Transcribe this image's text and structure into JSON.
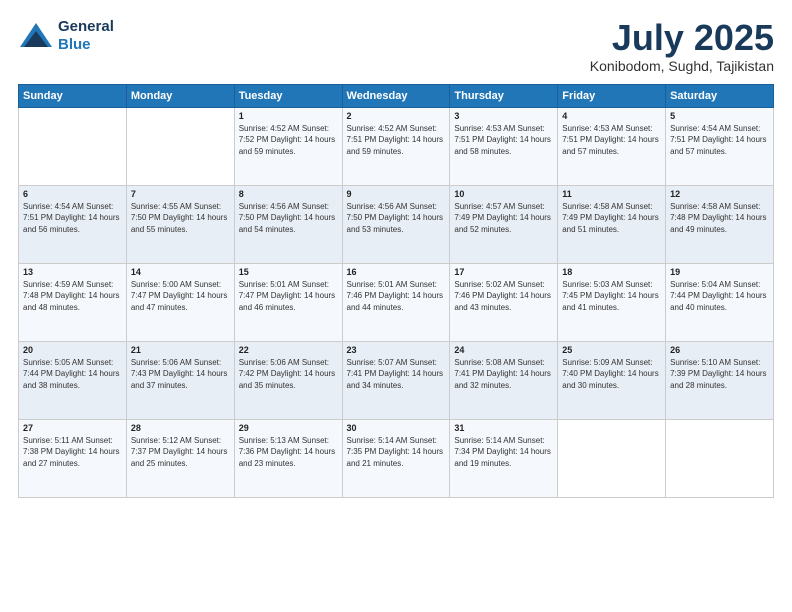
{
  "logo": {
    "line1": "General",
    "line2": "Blue"
  },
  "header": {
    "month": "July 2025",
    "location": "Konibodom, Sughd, Tajikistan"
  },
  "weekdays": [
    "Sunday",
    "Monday",
    "Tuesday",
    "Wednesday",
    "Thursday",
    "Friday",
    "Saturday"
  ],
  "weeks": [
    [
      {
        "num": "",
        "info": ""
      },
      {
        "num": "",
        "info": ""
      },
      {
        "num": "1",
        "info": "Sunrise: 4:52 AM\nSunset: 7:52 PM\nDaylight: 14 hours and 59 minutes."
      },
      {
        "num": "2",
        "info": "Sunrise: 4:52 AM\nSunset: 7:51 PM\nDaylight: 14 hours and 59 minutes."
      },
      {
        "num": "3",
        "info": "Sunrise: 4:53 AM\nSunset: 7:51 PM\nDaylight: 14 hours and 58 minutes."
      },
      {
        "num": "4",
        "info": "Sunrise: 4:53 AM\nSunset: 7:51 PM\nDaylight: 14 hours and 57 minutes."
      },
      {
        "num": "5",
        "info": "Sunrise: 4:54 AM\nSunset: 7:51 PM\nDaylight: 14 hours and 57 minutes."
      }
    ],
    [
      {
        "num": "6",
        "info": "Sunrise: 4:54 AM\nSunset: 7:51 PM\nDaylight: 14 hours and 56 minutes."
      },
      {
        "num": "7",
        "info": "Sunrise: 4:55 AM\nSunset: 7:50 PM\nDaylight: 14 hours and 55 minutes."
      },
      {
        "num": "8",
        "info": "Sunrise: 4:56 AM\nSunset: 7:50 PM\nDaylight: 14 hours and 54 minutes."
      },
      {
        "num": "9",
        "info": "Sunrise: 4:56 AM\nSunset: 7:50 PM\nDaylight: 14 hours and 53 minutes."
      },
      {
        "num": "10",
        "info": "Sunrise: 4:57 AM\nSunset: 7:49 PM\nDaylight: 14 hours and 52 minutes."
      },
      {
        "num": "11",
        "info": "Sunrise: 4:58 AM\nSunset: 7:49 PM\nDaylight: 14 hours and 51 minutes."
      },
      {
        "num": "12",
        "info": "Sunrise: 4:58 AM\nSunset: 7:48 PM\nDaylight: 14 hours and 49 minutes."
      }
    ],
    [
      {
        "num": "13",
        "info": "Sunrise: 4:59 AM\nSunset: 7:48 PM\nDaylight: 14 hours and 48 minutes."
      },
      {
        "num": "14",
        "info": "Sunrise: 5:00 AM\nSunset: 7:47 PM\nDaylight: 14 hours and 47 minutes."
      },
      {
        "num": "15",
        "info": "Sunrise: 5:01 AM\nSunset: 7:47 PM\nDaylight: 14 hours and 46 minutes."
      },
      {
        "num": "16",
        "info": "Sunrise: 5:01 AM\nSunset: 7:46 PM\nDaylight: 14 hours and 44 minutes."
      },
      {
        "num": "17",
        "info": "Sunrise: 5:02 AM\nSunset: 7:46 PM\nDaylight: 14 hours and 43 minutes."
      },
      {
        "num": "18",
        "info": "Sunrise: 5:03 AM\nSunset: 7:45 PM\nDaylight: 14 hours and 41 minutes."
      },
      {
        "num": "19",
        "info": "Sunrise: 5:04 AM\nSunset: 7:44 PM\nDaylight: 14 hours and 40 minutes."
      }
    ],
    [
      {
        "num": "20",
        "info": "Sunrise: 5:05 AM\nSunset: 7:44 PM\nDaylight: 14 hours and 38 minutes."
      },
      {
        "num": "21",
        "info": "Sunrise: 5:06 AM\nSunset: 7:43 PM\nDaylight: 14 hours and 37 minutes."
      },
      {
        "num": "22",
        "info": "Sunrise: 5:06 AM\nSunset: 7:42 PM\nDaylight: 14 hours and 35 minutes."
      },
      {
        "num": "23",
        "info": "Sunrise: 5:07 AM\nSunset: 7:41 PM\nDaylight: 14 hours and 34 minutes."
      },
      {
        "num": "24",
        "info": "Sunrise: 5:08 AM\nSunset: 7:41 PM\nDaylight: 14 hours and 32 minutes."
      },
      {
        "num": "25",
        "info": "Sunrise: 5:09 AM\nSunset: 7:40 PM\nDaylight: 14 hours and 30 minutes."
      },
      {
        "num": "26",
        "info": "Sunrise: 5:10 AM\nSunset: 7:39 PM\nDaylight: 14 hours and 28 minutes."
      }
    ],
    [
      {
        "num": "27",
        "info": "Sunrise: 5:11 AM\nSunset: 7:38 PM\nDaylight: 14 hours and 27 minutes."
      },
      {
        "num": "28",
        "info": "Sunrise: 5:12 AM\nSunset: 7:37 PM\nDaylight: 14 hours and 25 minutes."
      },
      {
        "num": "29",
        "info": "Sunrise: 5:13 AM\nSunset: 7:36 PM\nDaylight: 14 hours and 23 minutes."
      },
      {
        "num": "30",
        "info": "Sunrise: 5:14 AM\nSunset: 7:35 PM\nDaylight: 14 hours and 21 minutes."
      },
      {
        "num": "31",
        "info": "Sunrise: 5:14 AM\nSunset: 7:34 PM\nDaylight: 14 hours and 19 minutes."
      },
      {
        "num": "",
        "info": ""
      },
      {
        "num": "",
        "info": ""
      }
    ]
  ]
}
